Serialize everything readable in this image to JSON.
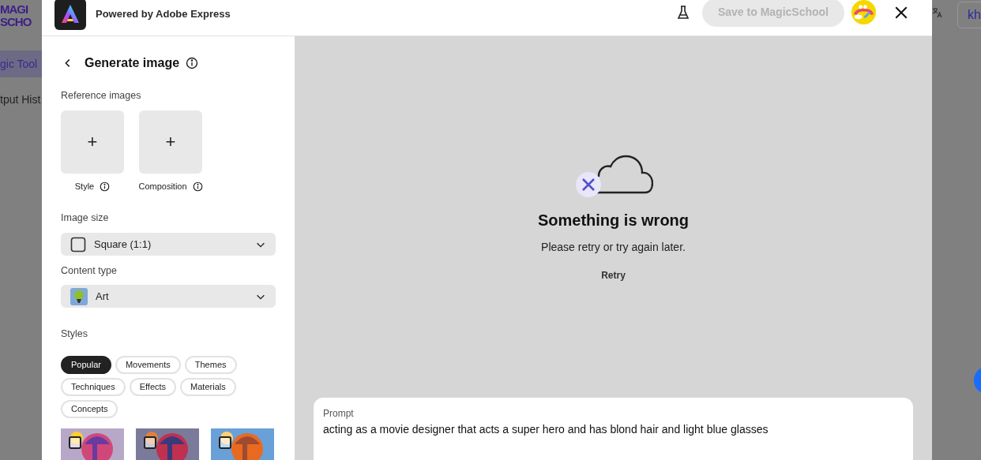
{
  "background_app": {
    "logo_lines": [
      "MAGI",
      "SCHO"
    ],
    "nav_items": [
      {
        "label": "gic Tool",
        "selected": true
      },
      {
        "label": "tput Hist",
        "selected": false
      }
    ],
    "language_button": "kh"
  },
  "header": {
    "title": "Powered by Adobe Express",
    "save_button": {
      "label": "Save to MagicSchool",
      "disabled": true
    }
  },
  "panel": {
    "title": "Generate image",
    "reference_label": "Reference images",
    "reference_slots": [
      {
        "label": "Style",
        "plus": "+"
      },
      {
        "label": "Composition",
        "plus": "+"
      }
    ],
    "image_size": {
      "label": "Image size",
      "value": "Square (1:1)"
    },
    "content_type": {
      "label": "Content type",
      "value": "Art"
    },
    "styles_label": "Styles",
    "style_tabs": [
      {
        "label": "Popular",
        "selected": true
      },
      {
        "label": "Movements",
        "selected": false
      },
      {
        "label": "Themes",
        "selected": false
      },
      {
        "label": "Techniques",
        "selected": false
      },
      {
        "label": "Effects",
        "selected": false
      },
      {
        "label": "Materials",
        "selected": false
      },
      {
        "label": "Concepts",
        "selected": false
      }
    ]
  },
  "error": {
    "title": "Something is wrong",
    "message": "Please retry or try again later.",
    "retry": "Retry"
  },
  "prompt": {
    "label": "Prompt",
    "value": "acting as a movie designer that acts a super hero and has blond hair and light blue glasses"
  }
}
